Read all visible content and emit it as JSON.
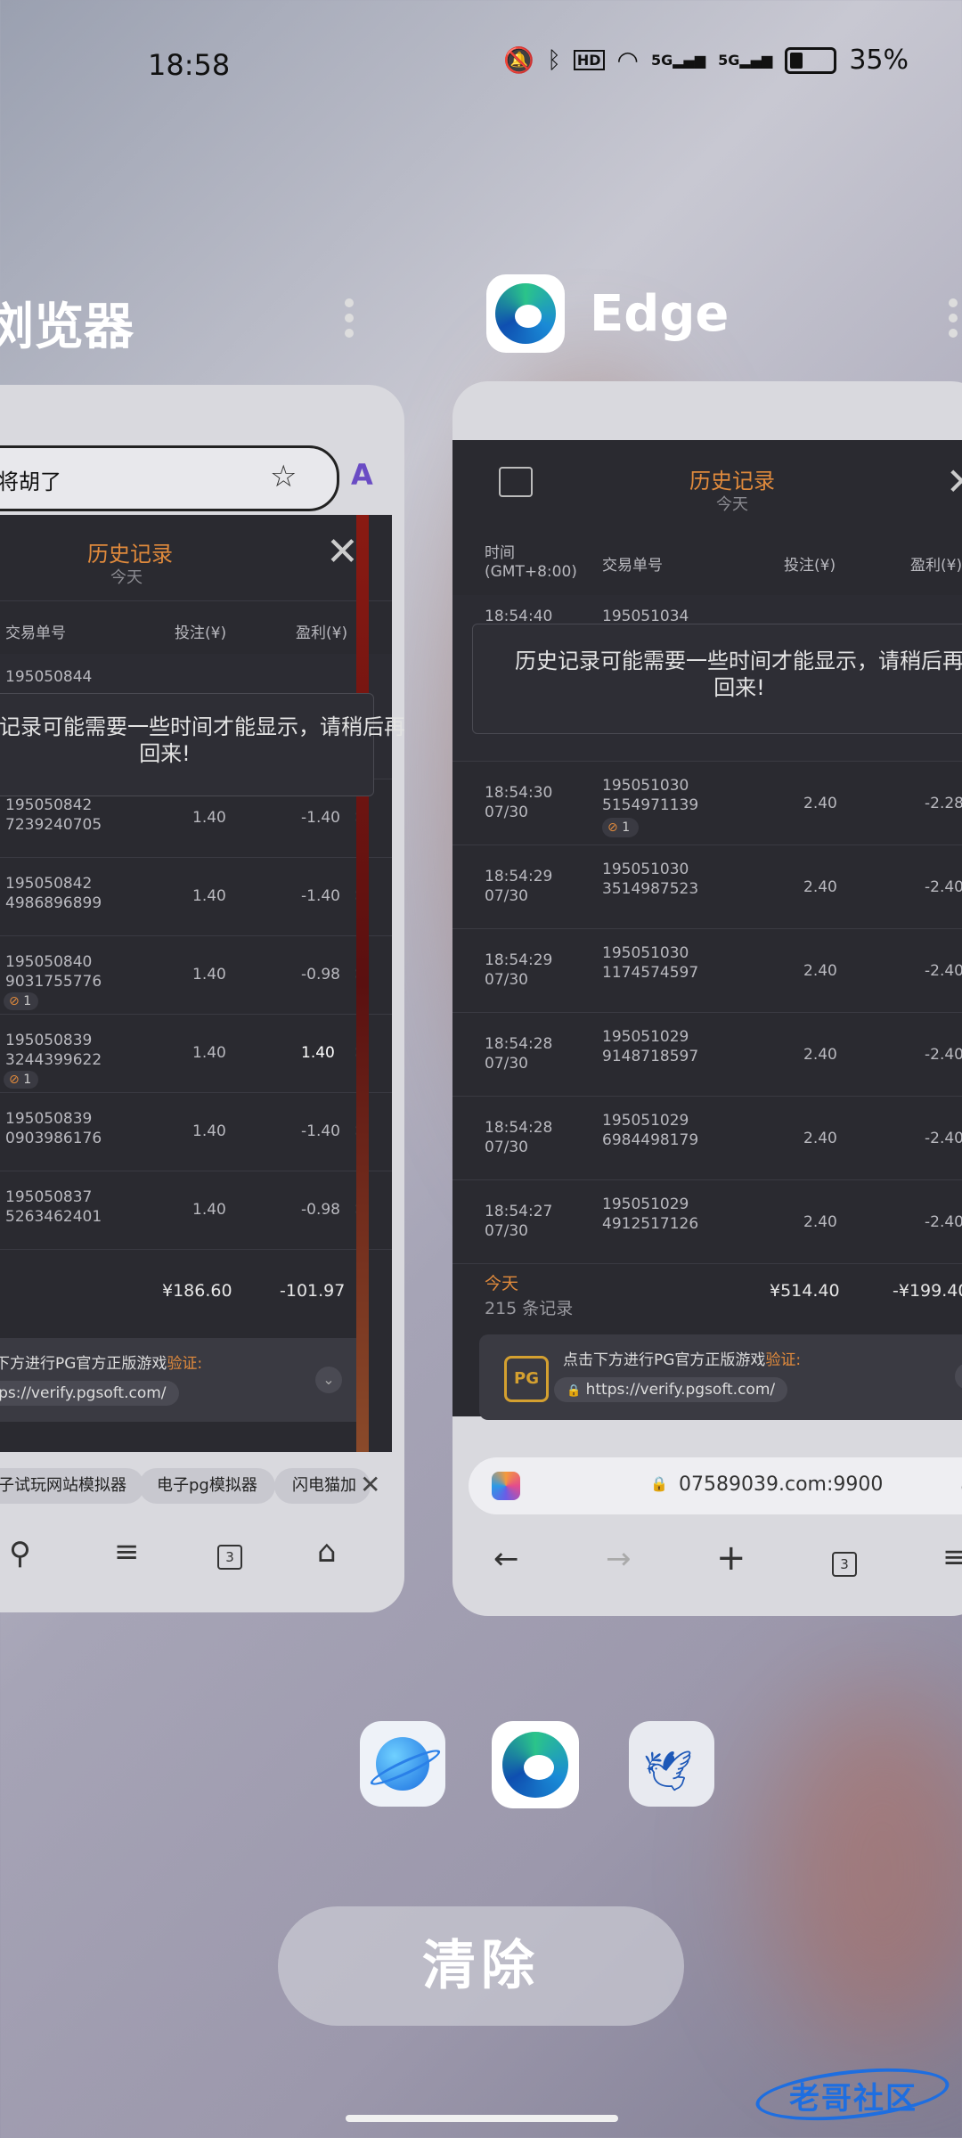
{
  "status_bar": {
    "time": "18:58",
    "battery": "35%",
    "network": "5G",
    "hd": "HD"
  },
  "left_app": {
    "name": "浏览器",
    "search_text": "麻将胡了",
    "history_title": "历史记录",
    "history_sub": "今天",
    "columns": [
      "交易单号",
      "投注(¥)",
      "盈利(¥)"
    ],
    "partial_id": "195050844",
    "notice": [
      "历史记录可能需要一些时间才能显示，请稍后再",
      "回来!"
    ],
    "rows": [
      {
        "id1": "195050842",
        "id2": "7239240705",
        "bet": "1.40",
        "profit": "-1.40",
        "badge": ""
      },
      {
        "id1": "195050842",
        "id2": "4986896899",
        "bet": "1.40",
        "profit": "-1.40",
        "badge": ""
      },
      {
        "id1": "195050840",
        "id2": "9031755776",
        "bet": "1.40",
        "profit": "-0.98",
        "badge": "1"
      },
      {
        "id1": "195050839",
        "id2": "3244399622",
        "bet": "1.40",
        "profit": "1.40",
        "badge": "1"
      },
      {
        "id1": "195050839",
        "id2": "0903986176",
        "bet": "1.40",
        "profit": "-1.40",
        "badge": ""
      },
      {
        "id1": "195050837",
        "id2": "5263462401",
        "bet": "1.40",
        "profit": "-0.98",
        "badge": ""
      }
    ],
    "total_bet": "¥186.60",
    "total_profit": "-101.97",
    "verify_text": "点击下方进行PG官方正版游戏",
    "verify_word": "验证:",
    "verify_url": "https://verify.pgsoft.com/",
    "chips": [
      "电子试玩网站模拟器",
      "电子pg模拟器",
      "闪电猫加"
    ],
    "tab_count": "3"
  },
  "right_app": {
    "name": "Edge",
    "history_title": "历史记录",
    "history_sub": "今天",
    "col_time": "时间",
    "col_tz": "(GMT+8:00)",
    "col_id": "交易单号",
    "col_bet": "投注(¥)",
    "col_profit": "盈利(¥)",
    "partial_time": "18:54:40",
    "partial_id": "195051034",
    "notice": [
      "历史记录可能需要一些时间才能显示，请稍后再",
      "回来!"
    ],
    "rows": [
      {
        "time": "18:54:30",
        "date": "07/30",
        "id1": "195051030",
        "id2": "5154971139",
        "bet": "2.40",
        "profit": "-2.28",
        "badge": "1"
      },
      {
        "time": "18:54:29",
        "date": "07/30",
        "id1": "195051030",
        "id2": "3514987523",
        "bet": "2.40",
        "profit": "-2.40",
        "badge": ""
      },
      {
        "time": "18:54:29",
        "date": "07/30",
        "id1": "195051030",
        "id2": "1174574597",
        "bet": "2.40",
        "profit": "-2.40",
        "badge": ""
      },
      {
        "time": "18:54:28",
        "date": "07/30",
        "id1": "195051029",
        "id2": "9148718597",
        "bet": "2.40",
        "profit": "-2.40",
        "badge": ""
      },
      {
        "time": "18:54:28",
        "date": "07/30",
        "id1": "195051029",
        "id2": "6984498179",
        "bet": "2.40",
        "profit": "-2.40",
        "badge": ""
      },
      {
        "time": "18:54:27",
        "date": "07/30",
        "id1": "195051029",
        "id2": "4912517126",
        "bet": "2.40",
        "profit": "-2.40",
        "badge": ""
      }
    ],
    "summary_label": "今天",
    "summary_count": "215 条记录",
    "total_bet": "¥514.40",
    "total_profit": "-¥199.40",
    "verify_text": "点击下方进行PG官方正版游戏",
    "verify_word": "验证:",
    "verify_url": "https://verify.pgsoft.com/",
    "pg_logo": "PG",
    "address": "07589039.com:9900",
    "tab_count": "3"
  },
  "dock": {
    "icons": [
      "browser-planet-icon",
      "edge-icon",
      "bird-app-icon"
    ]
  },
  "clear_label": "清除",
  "watermark": "老哥社区"
}
